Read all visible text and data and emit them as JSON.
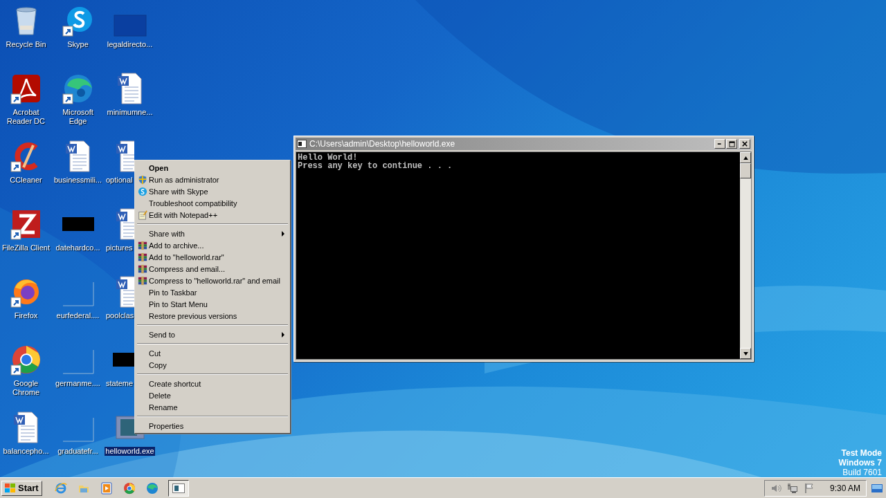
{
  "desktop": {
    "icons": [
      {
        "label": "Recycle Bin",
        "kind": "recycle-bin",
        "shortcut": false,
        "selected": false
      },
      {
        "label": "Acrobat Reader DC",
        "kind": "acrobat",
        "shortcut": true,
        "selected": false
      },
      {
        "label": "CCleaner",
        "kind": "ccleaner",
        "shortcut": true,
        "selected": false
      },
      {
        "label": "FileZilla Client",
        "kind": "filezilla",
        "shortcut": true,
        "selected": false
      },
      {
        "label": "Firefox",
        "kind": "firefox",
        "shortcut": true,
        "selected": false
      },
      {
        "label": "Google Chrome",
        "kind": "chrome",
        "shortcut": true,
        "selected": false
      },
      {
        "label": "balancepho...",
        "kind": "document",
        "shortcut": false,
        "selected": false
      },
      {
        "label": "Skype",
        "kind": "skype",
        "shortcut": true,
        "selected": false
      },
      {
        "label": "Microsoft Edge",
        "kind": "edge",
        "shortcut": true,
        "selected": false
      },
      {
        "label": "businessmili...",
        "kind": "document",
        "shortcut": false,
        "selected": false
      },
      {
        "label": "datehardco...",
        "kind": "black-thumbnail",
        "shortcut": false,
        "selected": false
      },
      {
        "label": "eurfederal....",
        "kind": "empty-thumbnail",
        "shortcut": false,
        "selected": false
      },
      {
        "label": "germanme....",
        "kind": "empty-thumbnail",
        "shortcut": false,
        "selected": false
      },
      {
        "label": "graduatefr...",
        "kind": "empty-thumbnail",
        "shortcut": false,
        "selected": false
      },
      {
        "label": "legaldirecto...",
        "kind": "dark-thumbnail",
        "shortcut": false,
        "selected": false
      },
      {
        "label": "minimumne...",
        "kind": "document",
        "shortcut": false,
        "selected": false
      },
      {
        "label": "optional",
        "kind": "document",
        "shortcut": false,
        "selected": false
      },
      {
        "label": "pictures",
        "kind": "document",
        "shortcut": false,
        "selected": false
      },
      {
        "label": "poolclas",
        "kind": "document",
        "shortcut": false,
        "selected": false
      },
      {
        "label": "stateme",
        "kind": "black-thumbnail",
        "shortcut": false,
        "selected": false
      },
      {
        "label": "helloworld.exe",
        "kind": "program",
        "shortcut": false,
        "selected": true
      }
    ]
  },
  "console_window": {
    "title": "C:\\Users\\admin\\Desktop\\helloworld.exe",
    "lines": [
      "Hello World!",
      "Press any key to continue . . ."
    ]
  },
  "context_menu": {
    "groups": [
      {
        "items": [
          {
            "label": "Open",
            "default": true,
            "submenu": false
          },
          {
            "label": "Run as administrator",
            "default": false,
            "submenu": false
          },
          {
            "label": "Share with Skype",
            "default": false,
            "submenu": false
          },
          {
            "label": "Troubleshoot compatibility",
            "default": false,
            "submenu": false
          },
          {
            "label": "Edit with Notepad++",
            "default": false,
            "submenu": false
          }
        ]
      },
      {
        "items": [
          {
            "label": "Share with",
            "default": false,
            "submenu": true
          },
          {
            "label": "Add to archive...",
            "default": false,
            "submenu": false
          },
          {
            "label": "Add to \"helloworld.rar\"",
            "default": false,
            "submenu": false
          },
          {
            "label": "Compress and email...",
            "default": false,
            "submenu": false
          },
          {
            "label": "Compress to \"helloworld.rar\" and email",
            "default": false,
            "submenu": false
          },
          {
            "label": "Pin to Taskbar",
            "default": false,
            "submenu": false
          },
          {
            "label": "Pin to Start Menu",
            "default": false,
            "submenu": false
          },
          {
            "label": "Restore previous versions",
            "default": false,
            "submenu": false
          }
        ]
      },
      {
        "items": [
          {
            "label": "Send to",
            "default": false,
            "submenu": true
          }
        ]
      },
      {
        "items": [
          {
            "label": "Cut",
            "default": false,
            "submenu": false
          },
          {
            "label": "Copy",
            "default": false,
            "submenu": false
          }
        ]
      },
      {
        "items": [
          {
            "label": "Create shortcut",
            "default": false,
            "submenu": false
          },
          {
            "label": "Delete",
            "default": false,
            "submenu": false
          },
          {
            "label": "Rename",
            "default": false,
            "submenu": false
          }
        ]
      },
      {
        "items": [
          {
            "label": "Properties",
            "default": false,
            "submenu": false
          }
        ]
      }
    ]
  },
  "os_notice": [
    {
      "text": "Test Mode",
      "bold": true
    },
    {
      "text": "Windows 7",
      "bold": true
    },
    {
      "text": "Build 7601",
      "bold": false
    }
  ],
  "taskbar": {
    "start": "Start",
    "quick_launch": [
      {
        "kind": "ie"
      },
      {
        "kind": "folder"
      },
      {
        "kind": "media"
      },
      {
        "kind": "chrome"
      },
      {
        "kind": "edge"
      }
    ],
    "tasks": [
      {
        "kind": "console",
        "selected": true
      }
    ],
    "clock": "9:30 AM"
  }
}
